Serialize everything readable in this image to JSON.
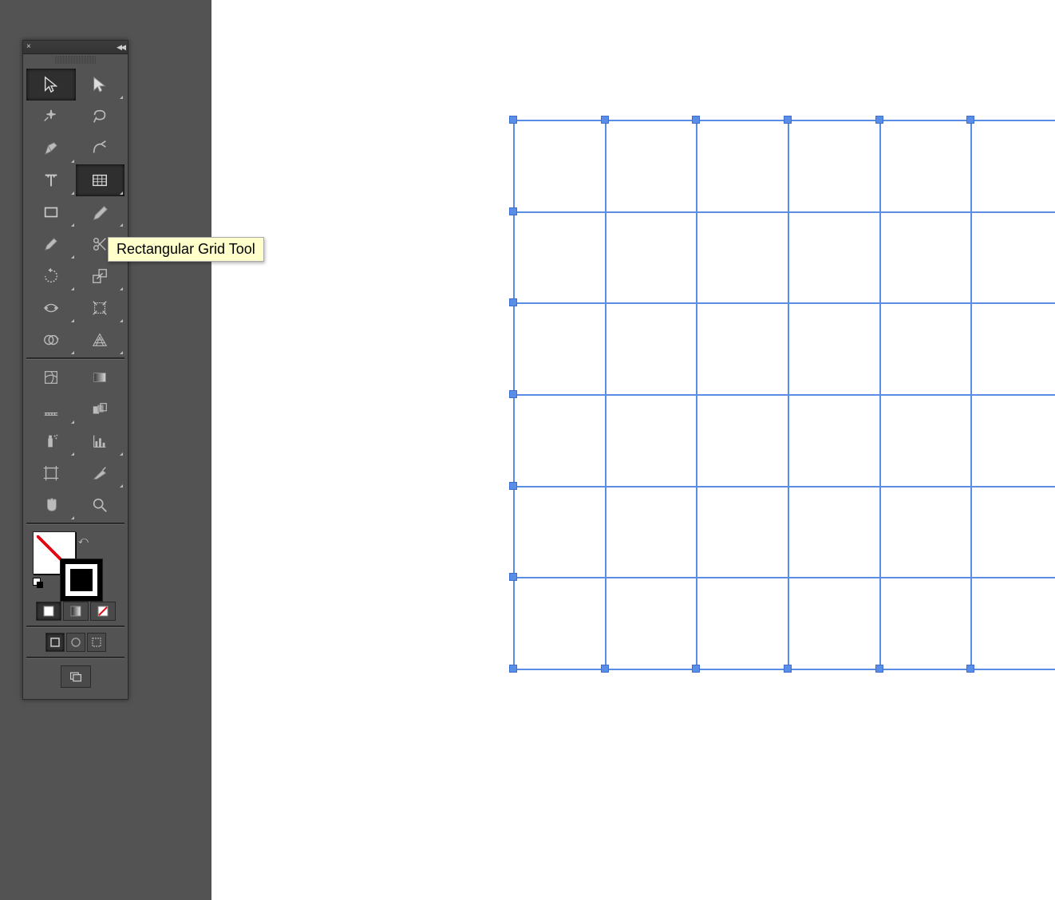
{
  "tooltip": {
    "text": "Rectangular Grid Tool"
  },
  "tools": {
    "row0": [
      "selection-tool",
      "direct-selection-tool"
    ],
    "row1": [
      "magic-wand-tool",
      "lasso-tool"
    ],
    "row2": [
      "pen-tool",
      "curvature-tool"
    ],
    "row3": [
      "type-tool",
      "rectangular-grid-tool"
    ],
    "row4": [
      "rectangle-tool",
      "paintbrush-tool"
    ],
    "row5": [
      "pencil-tool",
      "scissors-tool"
    ],
    "row6": [
      "rotate-tool",
      "scale-tool"
    ],
    "row7": [
      "width-tool",
      "free-transform-tool"
    ],
    "row8": [
      "shape-builder-tool",
      "perspective-grid-tool"
    ],
    "row9": [
      "mesh-tool",
      "gradient-tool"
    ],
    "row10": [
      "eyedropper-tool",
      "blend-tool"
    ],
    "row11": [
      "symbol-sprayer-tool",
      "column-graph-tool"
    ],
    "row12": [
      "artboard-tool",
      "slice-tool"
    ],
    "row13": [
      "hand-tool",
      "zoom-tool"
    ]
  },
  "active_tool": "rectangular-grid-tool",
  "selected_tool_top": "selection-tool",
  "fill": "none",
  "stroke": "#000000",
  "color_modes": [
    "solid",
    "gradient",
    "none"
  ],
  "screen_modes": [
    "normal",
    "full-with-menu",
    "full"
  ],
  "grid": {
    "columns": 6,
    "rows": 6,
    "stroke_color": "#5a8ee6",
    "selected": true
  },
  "selection_handles": {
    "per_side": 7
  }
}
